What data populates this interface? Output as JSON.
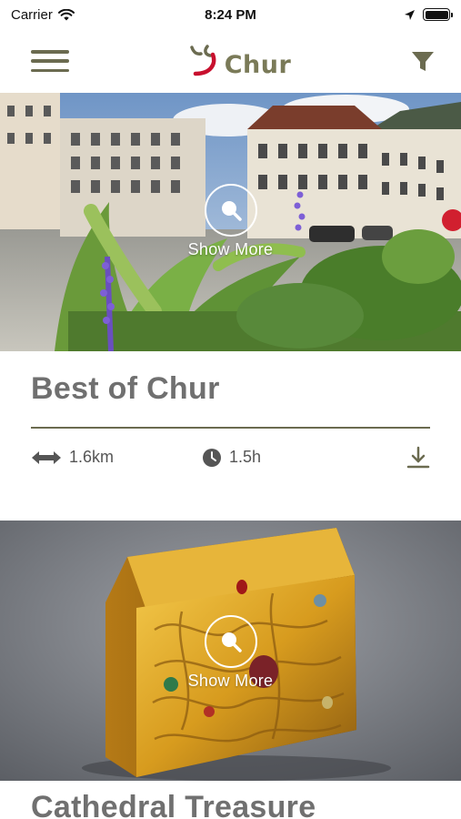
{
  "status_bar": {
    "carrier": "Carrier",
    "time": "8:24 PM"
  },
  "header": {
    "logo_text": "Chur",
    "menu_icon": "hamburger-menu-icon",
    "filter_icon": "filter-funnel-icon"
  },
  "colors": {
    "accent_olive": "#6b6b50",
    "logo_red": "#c8102e",
    "title_gray": "#707070"
  },
  "tours": [
    {
      "title": "Best of Chur",
      "show_more_label": "Show More",
      "distance": "1.6km",
      "duration": "1.5h",
      "image": "town-square-with-flowers"
    },
    {
      "title": "Cathedral Treasure",
      "show_more_label": "Show More",
      "image": "golden-reliquary-box"
    }
  ]
}
